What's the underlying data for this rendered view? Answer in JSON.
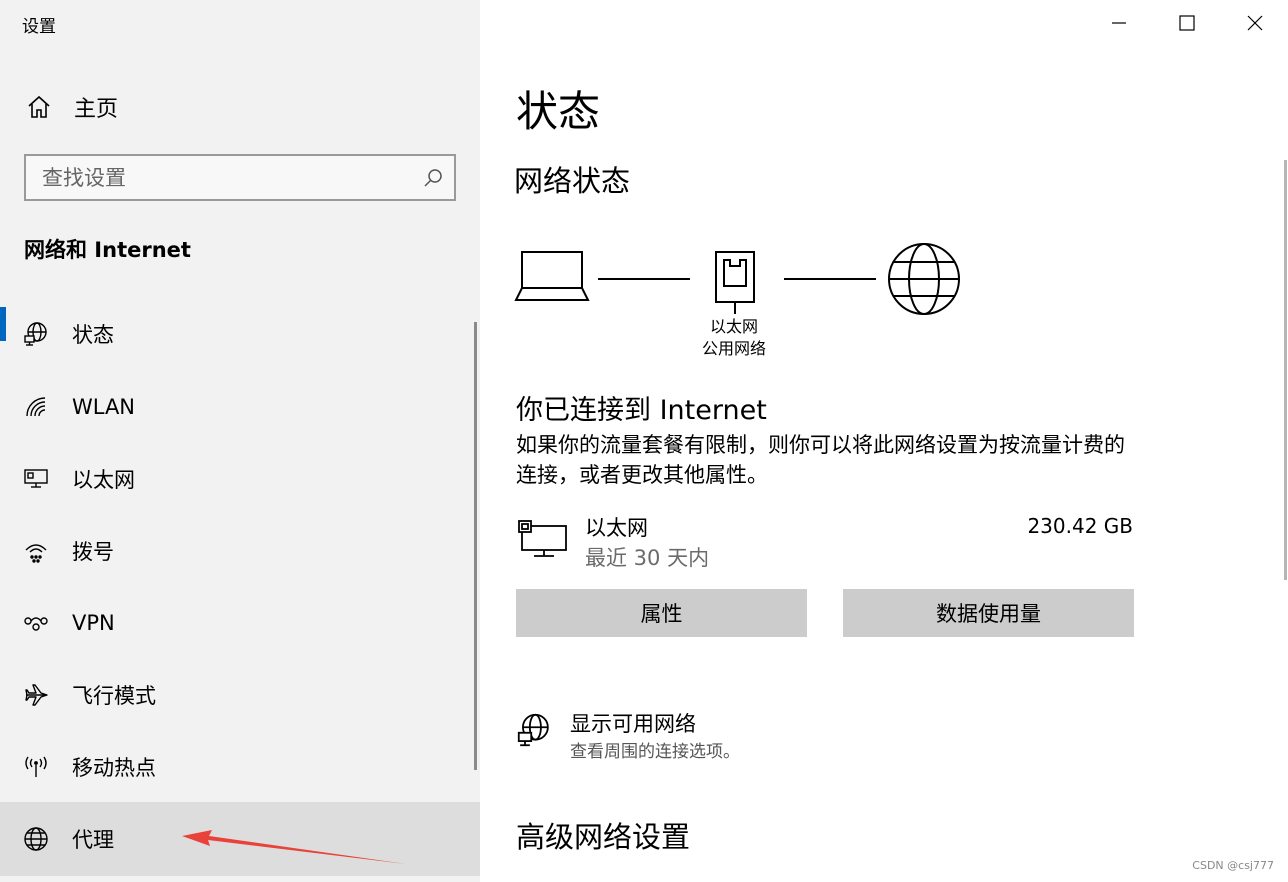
{
  "window": {
    "title": "设置"
  },
  "sidebar": {
    "home_label": "主页",
    "search_placeholder": "查找设置",
    "section_title": "网络和 Internet",
    "items": [
      {
        "label": "状态",
        "icon": "status-globe-icon"
      },
      {
        "label": "WLAN",
        "icon": "wifi-icon"
      },
      {
        "label": "以太网",
        "icon": "ethernet-icon"
      },
      {
        "label": "拨号",
        "icon": "dialup-icon"
      },
      {
        "label": "VPN",
        "icon": "vpn-icon"
      },
      {
        "label": "飞行模式",
        "icon": "airplane-icon"
      },
      {
        "label": "移动热点",
        "icon": "hotspot-icon"
      },
      {
        "label": "代理",
        "icon": "globe-icon"
      }
    ]
  },
  "main": {
    "title": "状态",
    "network_status_heading": "网络状态",
    "diagram": {
      "line1": "以太网",
      "line2": "公用网络"
    },
    "connected_text": "你已连接到 Internet",
    "description": "如果你的流量套餐有限制，则你可以将此网络设置为按流量计费的连接，或者更改其他属性。",
    "adapter": {
      "name": "以太网",
      "period": "最近 30 天内",
      "usage": "230.42 GB"
    },
    "buttons": {
      "properties": "属性",
      "data_usage": "数据使用量"
    },
    "available": {
      "title": "显示可用网络",
      "subtitle": "查看周围的连接选项。"
    },
    "advanced_heading": "高级网络设置"
  },
  "watermark": "CSDN @csj777",
  "colors": {
    "accent": "#0067c0",
    "button_bg": "#cccccc",
    "sidebar_bg": "#f2f2f2",
    "arrow": "#e8423a"
  }
}
